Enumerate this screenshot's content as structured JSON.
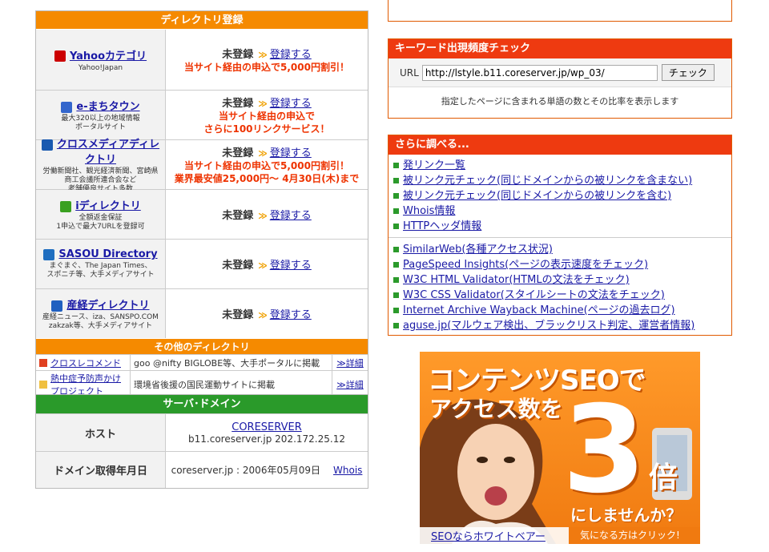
{
  "directory": {
    "title": "ディレクトリ登録",
    "status_label": "未登録",
    "register_label": "登録する",
    "entries": [
      {
        "name": "Yahooカテゴリ",
        "sub": [
          "Yahoo!Japan"
        ],
        "promo": [
          "当サイト経由の申込で5,000円割引！"
        ],
        "icon_color": "#cc0000",
        "icon": "yahoo-icon"
      },
      {
        "name": "e-まちタウン",
        "sub": [
          "最大320以上の地域情報",
          "ポータルサイト"
        ],
        "promo": [
          "当サイト経由の申込で",
          "さらに100リンクサービス！"
        ],
        "icon_color": "#3366cc",
        "icon": "emachi-icon"
      },
      {
        "name": "クロスメディアディレクトリ",
        "sub": [
          "労働新聞社、観光経済新聞、宮崎県",
          "商工会議所連合会など",
          "老舗優良サイト多数"
        ],
        "promo": [
          "当サイト経由の申込で5,000円割引！",
          "業界最安値25,000円～ 4月30日(木)まで"
        ],
        "icon_color": "#1a5ab0",
        "icon": "crossmedia-icon"
      },
      {
        "name": "iディレクトリ",
        "sub": [
          "全額返金保証",
          "1申込で最大7URLを登録可"
        ],
        "promo": [],
        "icon_color": "#3aa020",
        "icon": "idirectory-icon"
      },
      {
        "name": "SASOU Directory",
        "sub": [
          "まぐまぐ、The Japan Times、",
          "スポニチ等、大手メディアサイト"
        ],
        "promo": [],
        "icon_color": "#1f6ec0",
        "icon": "sasou-icon"
      },
      {
        "name": "産経ディレクトリ",
        "sub": [
          "産経ニュース、iza、SANSPO.COM",
          "zakzak等、大手メディアサイト"
        ],
        "promo": [],
        "icon_color": "#2060c0",
        "icon": "sankei-icon"
      }
    ],
    "other_title": "その他のディレクトリ",
    "others": [
      {
        "name": "クロスレコメンド",
        "desc": "goo @nifty BIGLOBE等、大手ポータルに掲載",
        "link": "≫詳細"
      },
      {
        "name": "熱中症予防声かけプロジェクト",
        "desc": "環境省後援の国民運動サイトに掲載",
        "link": "≫詳細"
      }
    ]
  },
  "server": {
    "title": "サーバ･ドメイン",
    "host_label": "ホスト",
    "host_name": "CORESERVER",
    "host_value": "b11.coreserver.jp 202.172.25.12",
    "domain_label": "ドメイン取得年月日",
    "domain_value": "coreserver.jp : 2006年05月09日",
    "whois_label": "Whois"
  },
  "keyword_check": {
    "title": "キーワード出現頻度チェック",
    "url_label": "URL",
    "url_value": "http://lstyle.b11.coreserver.jp/wp_03/",
    "button_label": "チェック",
    "description": "指定したページに含まれる単語の数とその比率を表示します"
  },
  "more": {
    "title": "さらに調べる...",
    "group1": [
      "発リンク一覧",
      "被リンク元チェック(同じドメインからの被リンクを含まない)",
      "被リンク元チェック(同じドメインからの被リンクを含む)",
      "Whois情報",
      "HTTPヘッダ情報"
    ],
    "group2": [
      "SimilarWeb(各種アクセス状況)",
      "PageSpeed Insights(ページの表示速度をチェック)",
      "W3C HTML Validator(HTMLの文法をチェック)",
      "W3C CSS Validator(スタイルシートの文法をチェック)",
      "Internet Archive Wayback Machine(ページの過去ログ)",
      "aguse.jp(マルウェア検出、ブラックリスト判定、運営者情報)"
    ]
  },
  "ad": {
    "line1": "コンテンツSEOで",
    "line2": "アクセス数を",
    "big": "3",
    "bai": "倍",
    "line3": "にしませんか？",
    "link": "SEOならホワイトベアー",
    "cta": "気になる方はクリック!"
  }
}
